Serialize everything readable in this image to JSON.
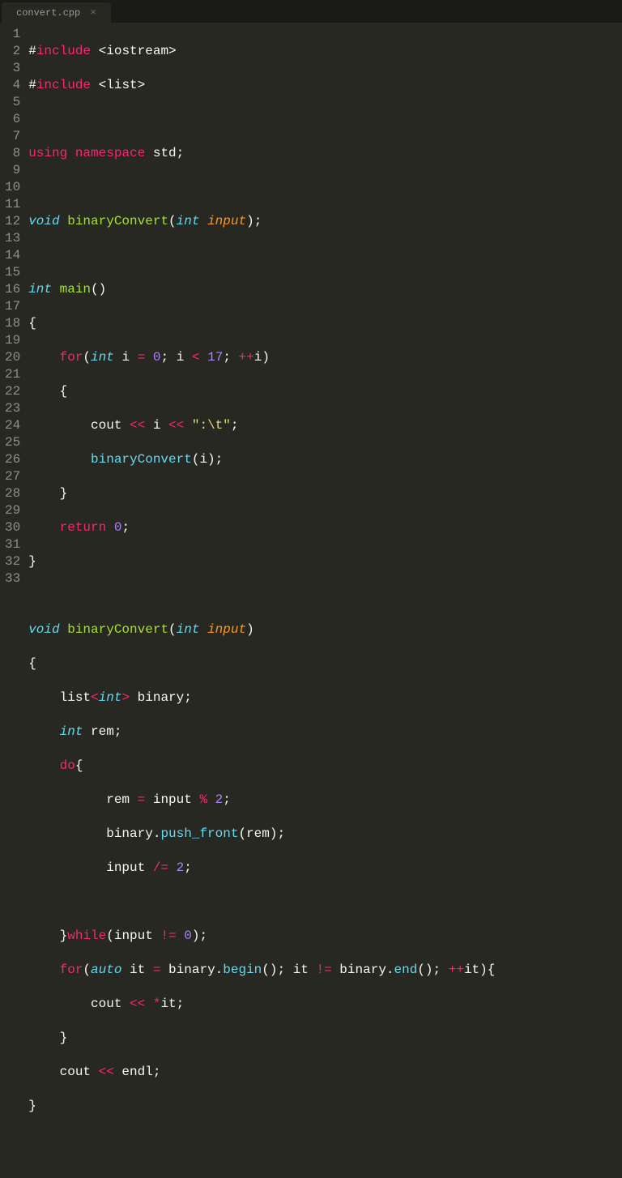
{
  "tab": {
    "title": "convert.cpp",
    "close": "×"
  },
  "gutter": {
    "lines": [
      "1",
      "2",
      "3",
      "4",
      "5",
      "6",
      "7",
      "8",
      "9",
      "10",
      "11",
      "12",
      "13",
      "14",
      "15",
      "16",
      "17",
      "18",
      "19",
      "20",
      "21",
      "22",
      "23",
      "24",
      "25",
      "26",
      "27",
      "28",
      "29",
      "30",
      "31",
      "32",
      "33"
    ]
  },
  "code": {
    "l1": {
      "t1": "#",
      "t2": "include",
      "t3": " <iostream>"
    },
    "l2": {
      "t1": "#",
      "t2": "include",
      "t3": " <list>"
    },
    "l4": {
      "t1": "using",
      "t2": " ",
      "t3": "namespace",
      "t4": " std;"
    },
    "l6": {
      "t1": "void",
      "t2": " ",
      "t3": "binaryConvert",
      "t4": "(",
      "t5": "int",
      "t6": " ",
      "t7": "input",
      "t8": ");"
    },
    "l8": {
      "t1": "int",
      "t2": " ",
      "t3": "main",
      "t4": "()"
    },
    "l9": {
      "t1": "{"
    },
    "l10": {
      "t1": "    ",
      "t2": "for",
      "t3": "(",
      "t4": "int",
      "t5": " i ",
      "t6": "=",
      "t7": " ",
      "t8": "0",
      "t9": "; i ",
      "t10": "<",
      "t11": " ",
      "t12": "17",
      "t13": "; ",
      "t14": "++",
      "t15": "i)"
    },
    "l11": {
      "t1": "    {"
    },
    "l12": {
      "t1": "        cout ",
      "t2": "<<",
      "t3": " i ",
      "t4": "<<",
      "t5": " ",
      "t6": "\":\\t\"",
      "t7": ";"
    },
    "l13": {
      "t1": "        ",
      "t2": "binaryConvert",
      "t3": "(i);"
    },
    "l14": {
      "t1": "    }"
    },
    "l15": {
      "t1": "    ",
      "t2": "return",
      "t3": " ",
      "t4": "0",
      "t5": ";"
    },
    "l16": {
      "t1": "}"
    },
    "l18": {
      "t1": "void",
      "t2": " ",
      "t3": "binaryConvert",
      "t4": "(",
      "t5": "int",
      "t6": " ",
      "t7": "input",
      "t8": ")"
    },
    "l19": {
      "t1": "{"
    },
    "l20": {
      "t1": "    list",
      "t2": "<",
      "t3": "int",
      "t4": ">",
      "t5": " binary;"
    },
    "l21": {
      "t1": "    ",
      "t2": "int",
      "t3": " rem;"
    },
    "l22": {
      "t1": "    ",
      "t2": "do",
      "t3": "{"
    },
    "l23": {
      "t1": "          rem ",
      "t2": "=",
      "t3": " input ",
      "t4": "%",
      "t5": " ",
      "t6": "2",
      "t7": ";"
    },
    "l24": {
      "t1": "          binary.",
      "t2": "push_front",
      "t3": "(rem);"
    },
    "l25": {
      "t1": "          input ",
      "t2": "/=",
      "t3": " ",
      "t4": "2",
      "t5": ";"
    },
    "l27": {
      "t1": "    }",
      "t2": "while",
      "t3": "(input ",
      "t4": "!=",
      "t5": " ",
      "t6": "0",
      "t7": ");"
    },
    "l28": {
      "t1": "    ",
      "t2": "for",
      "t3": "(",
      "t4": "auto",
      "t5": " it ",
      "t6": "=",
      "t7": " binary.",
      "t8": "begin",
      "t9": "(); it ",
      "t10": "!=",
      "t11": " binary.",
      "t12": "end",
      "t13": "(); ",
      "t14": "++",
      "t15": "it){"
    },
    "l29": {
      "t1": "        cout ",
      "t2": "<<",
      "t3": " ",
      "t4": "*",
      "t5": "it;"
    },
    "l30": {
      "t1": "    }"
    },
    "l31": {
      "t1": "    cout ",
      "t2": "<<",
      "t3": " endl;"
    },
    "l32": {
      "t1": "}"
    }
  }
}
